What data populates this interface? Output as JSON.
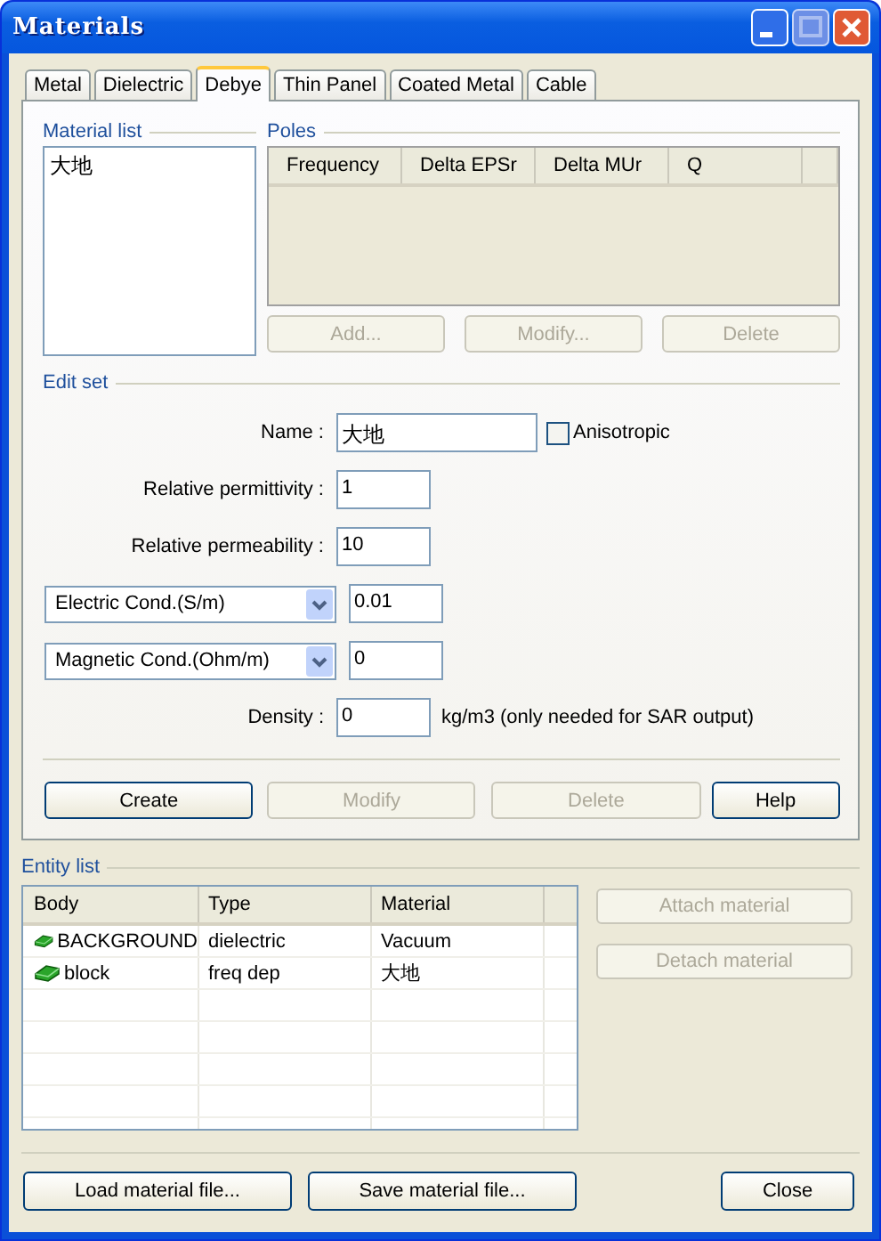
{
  "window": {
    "title": "Materials"
  },
  "tabs": [
    {
      "label": "Metal",
      "selected": false
    },
    {
      "label": "Dielectric",
      "selected": false
    },
    {
      "label": "Debye",
      "selected": true
    },
    {
      "label": "Thin Panel",
      "selected": false
    },
    {
      "label": "Coated Metal",
      "selected": false
    },
    {
      "label": "Cable",
      "selected": false
    }
  ],
  "material_list": {
    "label": "Material list",
    "items": [
      {
        "label": "大地",
        "selected": false
      }
    ]
  },
  "poles": {
    "label": "Poles",
    "columns": [
      "Frequency",
      "Delta EPSr",
      "Delta MUr",
      "Q"
    ],
    "buttons": [
      {
        "label": "Add...",
        "disabled": true
      },
      {
        "label": "Modify...",
        "disabled": true
      },
      {
        "label": "Delete",
        "disabled": true
      }
    ]
  },
  "edit_set": {
    "label": "Edit set",
    "name": {
      "label": "Name :",
      "value": "大地"
    },
    "anisotropic": {
      "label": "Anisotropic",
      "checked": false
    },
    "fields": [
      {
        "kind": "label",
        "label": "Relative permittivity :",
        "value": "1"
      },
      {
        "kind": "label",
        "label": "Relative permeability :",
        "value": "10"
      },
      {
        "kind": "dropdown",
        "label": "Electric Cond.(S/m)",
        "value": "0.01"
      },
      {
        "kind": "dropdown",
        "label": "Magnetic Cond.(Ohm/m)",
        "value": "0"
      },
      {
        "kind": "label",
        "label": "Density :",
        "value": "0",
        "unit": "kg/m3  (only needed for SAR output)"
      }
    ],
    "buttons": [
      {
        "label": "Create",
        "disabled": false
      },
      {
        "label": "Modify",
        "disabled": true
      },
      {
        "label": "Delete",
        "disabled": true
      },
      {
        "label": "Help",
        "disabled": false
      }
    ]
  },
  "entity_list": {
    "label": "Entity list",
    "columns": [
      "Body",
      "Type",
      "Material"
    ],
    "rows": [
      {
        "body": "BACKGROUND",
        "type": "dielectric",
        "material": "Vacuum"
      },
      {
        "body": "block",
        "type": "freq dep",
        "material": "大地"
      }
    ],
    "buttons": [
      {
        "label": "Attach material",
        "disabled": true
      },
      {
        "label": "Detach material",
        "disabled": true
      }
    ]
  },
  "footer_buttons": [
    {
      "label": "Load material file...",
      "disabled": false
    },
    {
      "label": "Save material file...",
      "disabled": false
    },
    {
      "label": "Close",
      "disabled": false
    }
  ]
}
